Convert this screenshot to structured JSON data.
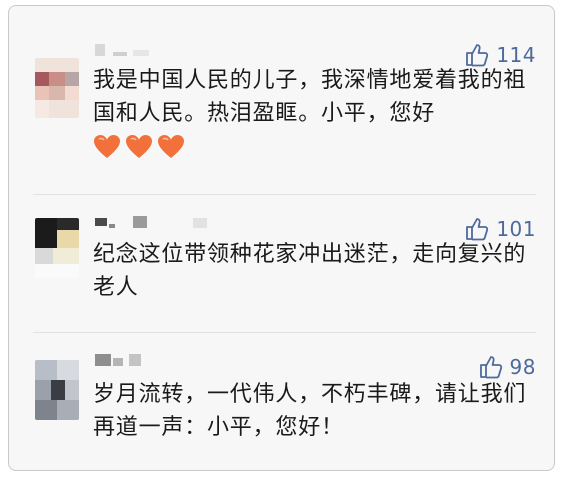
{
  "comments": [
    {
      "likes": "114",
      "text": "我是中国人民的儿子，我深情地爱着我的祖国和人民。热泪盈眶。小平，您好",
      "reactions": [
        "orange-heart",
        "orange-heart",
        "orange-heart"
      ]
    },
    {
      "likes": "101",
      "text": "纪念这位带领种花家冲出迷茫，走向复兴的老人"
    },
    {
      "likes": "98",
      "text": "岁月流转，一代伟人，不朽丰碑，请让我们再道一声：小平，您好！"
    }
  ],
  "colors": {
    "like_blue": "#4e6a9c",
    "heart_orange": "#f2703a"
  }
}
